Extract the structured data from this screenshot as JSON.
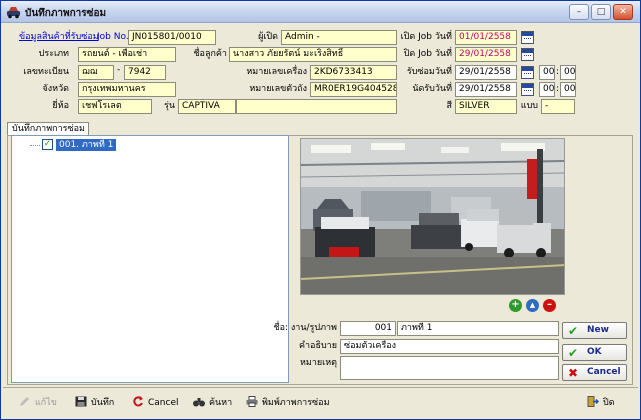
{
  "window": {
    "title": "บันทึกภาพการซ่อม",
    "min": "–",
    "max": "□",
    "close": "✕"
  },
  "form": {
    "link_label": "ข้อมูลสินค้าที่รับซ่อม",
    "job_no_label": "Job No.",
    "job_no": "JN015801/0010",
    "opener_label": "ผู้เปิด",
    "opener": "Admin -",
    "open_date_label": "เปิด Job วันที่",
    "open_date": "01/01/2558",
    "type_label": "ประเภท",
    "type": "รถยนต์ - เพื่อเช่า",
    "customer_label": "ชื่อลูกค้า",
    "customer": "นางสาว ภัยยรัตน์ มะเริงสิทธิ์",
    "close_date_label": "ปิด Job วันที่",
    "close_date": "29/01/2558",
    "reg_label": "เลขทะเบียน",
    "reg_prefix": "ฌฌ",
    "reg_dash": "-",
    "reg_no": "7942",
    "engine_label": "หมายเลขเครื่อง",
    "engine_no": "2KD6733413",
    "receive_label": "รับซ่อมวันที่",
    "receive_date": "29/01/2558",
    "receive_hh": "00",
    "receive_mm": "00",
    "province_label": "จังหวัด",
    "province": "กรุงเทพมหานคร",
    "chassis_label": "หมายเลขตัวถัง",
    "chassis_no": "MR0ER19G40452860",
    "appoint_label": "นัดรับวันที่",
    "appoint_date": "29/01/2558",
    "appoint_hh": "00",
    "appoint_mm": "00",
    "brand_label": "ยี่ห้อ",
    "brand": "เชฟโรเลต",
    "model_label": "รุ่น",
    "model": "CAPTIVA",
    "color_label": "สี",
    "color": "SILVER",
    "variant_label": "แบบ",
    "variant": "-",
    "time_sep": ":"
  },
  "tab": {
    "label": "บันทึกภาพการซ่อม"
  },
  "tree": {
    "item": "001. ภาพที่ 1",
    "checked": "✓"
  },
  "photo_controls": {
    "add": "+",
    "up": "▲",
    "remove": "–"
  },
  "detail": {
    "name_label": "ชื่อ: งาน/รูปภาพ",
    "seq": "001",
    "name": "ภาพที่ 1",
    "desc_label": "คำอธิบาย",
    "desc": "ซ่อมตัวเครื่อง",
    "note_label": "หมายเหตุ",
    "note": ""
  },
  "actions": {
    "new": "New",
    "ok": "OK",
    "cancel": "Cancel"
  },
  "toolbar": {
    "edit": "แก้ไข",
    "save": "บันทึก",
    "cancel": "Cancel",
    "search": "ค้นหา",
    "print": "พิมพ์ภาพการซ่อม",
    "close": "ปิด"
  },
  "colors": {
    "field_bg": "#ffffcc",
    "selection": "#316ac5",
    "accent_green": "#21a121",
    "accent_red": "#cc1111"
  }
}
